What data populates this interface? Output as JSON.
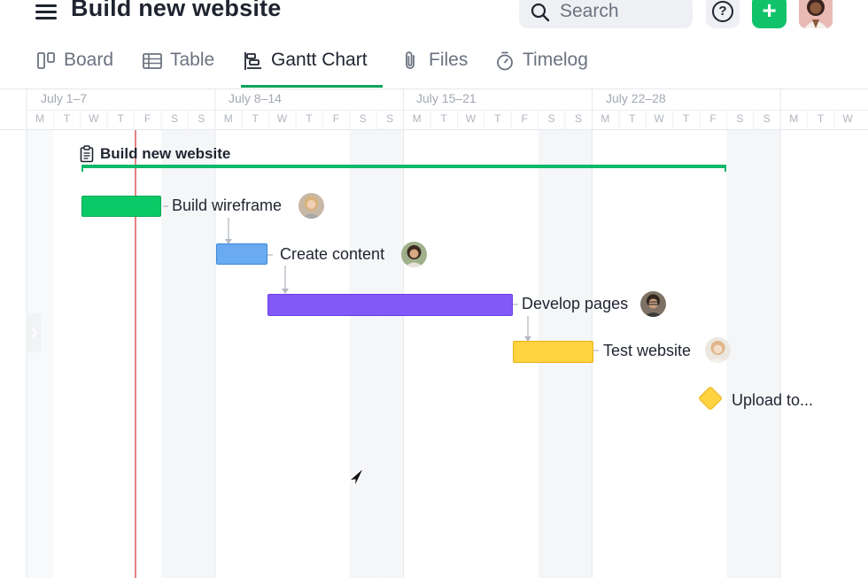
{
  "header": {
    "title": "Build new website",
    "search_placeholder": "Search",
    "add_label": "+",
    "help_label": "?"
  },
  "tabs": [
    {
      "label": "Board",
      "icon": "board-icon"
    },
    {
      "label": "Table",
      "icon": "table-icon"
    },
    {
      "label": "Gantt Chart",
      "icon": "gantt-icon",
      "active": true
    },
    {
      "label": "Files",
      "icon": "paperclip-icon"
    },
    {
      "label": "Timelog",
      "icon": "stopwatch-icon"
    }
  ],
  "timeline": {
    "weeks": [
      "July 1–7",
      "July 8–14",
      "July 15–21",
      "July 22–28"
    ],
    "days": [
      "M",
      "T",
      "W",
      "T",
      "F",
      "S",
      "S",
      "M",
      "T",
      "W",
      "T",
      "F",
      "S",
      "S",
      "M",
      "T",
      "W",
      "T",
      "F",
      "S",
      "S",
      "M",
      "T",
      "W",
      "T",
      "F",
      "S",
      "S",
      "M",
      "T",
      "W"
    ]
  },
  "project": {
    "name": "Build new website",
    "icon": "clipboard-icon",
    "bar_color": "#10b86a"
  },
  "tasks": [
    {
      "label": "Build wireframe",
      "color": "#0bc966",
      "border": "#09a956",
      "avatar": "avatar-woman-blonde"
    },
    {
      "label": "Create content",
      "color": "#6aaaf0",
      "border": "#3c86d9",
      "avatar": "avatar-woman-dark-hair"
    },
    {
      "label": "Develop pages",
      "color": "#8259f7",
      "border": "#6b3fe6",
      "avatar": "avatar-man-glasses"
    },
    {
      "label": "Test website",
      "color": "#ffd23f",
      "border": "#e9b21a",
      "avatar": "avatar-woman-red-hair"
    },
    {
      "label": "Upload to...",
      "color": "#ffd23f",
      "border": "#e9b21a",
      "milestone": true
    }
  ],
  "today_line_color": "#e26b6b"
}
